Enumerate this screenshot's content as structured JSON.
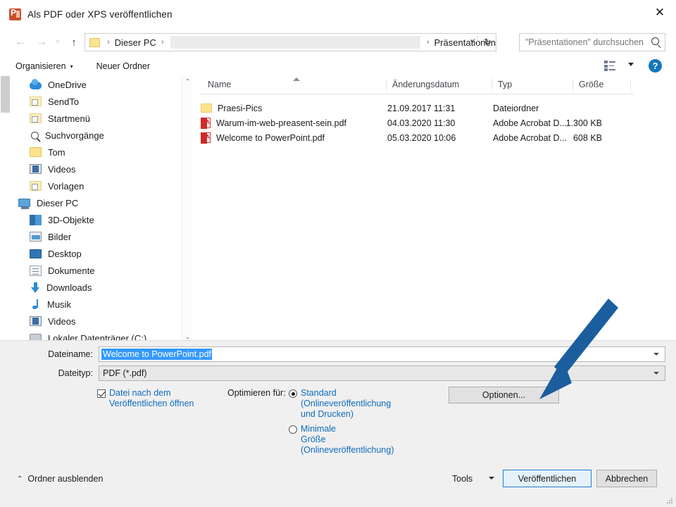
{
  "window": {
    "title": "Als PDF oder XPS veröffentlichen",
    "app_icon": "powerpoint-icon",
    "close_label": "✕"
  },
  "nav": {
    "back_icon": "←",
    "forward_icon": "→",
    "recent_icon": "˅",
    "up_icon": "↑"
  },
  "address": {
    "crumb_root": "Dieser PC",
    "crumb_current": "Präsentationen",
    "separator": "›",
    "dropdown_icon": "˅",
    "refresh_icon": "↻"
  },
  "search": {
    "placeholder": "\"Präsentationen\" durchsuchen",
    "icon": "search-icon"
  },
  "commandbar": {
    "organize_label": "Organisieren",
    "organize_caret": "▾",
    "new_folder_label": "Neuer Ordner",
    "view_icon": "view-layout-icon",
    "view_caret": "▾",
    "help_label": "?"
  },
  "sidebar": {
    "items": [
      {
        "label": "OneDrive",
        "icon": "cloud-icon",
        "indent": "child"
      },
      {
        "label": "SendTo",
        "icon": "folder-shortcut-icon",
        "indent": "child"
      },
      {
        "label": "Startmenü",
        "icon": "folder-shortcut-icon",
        "indent": "child"
      },
      {
        "label": "Suchvorgänge",
        "icon": "search-folder-icon",
        "indent": "child"
      },
      {
        "label": "Tom",
        "icon": "folder-icon",
        "indent": "child"
      },
      {
        "label": "Videos",
        "icon": "video-folder-icon",
        "indent": "child"
      },
      {
        "label": "Vorlagen",
        "icon": "folder-shortcut-icon",
        "indent": "child"
      },
      {
        "label": "Dieser PC",
        "icon": "computer-icon",
        "indent": "root"
      },
      {
        "label": "3D-Objekte",
        "icon": "3d-objects-icon",
        "indent": "child"
      },
      {
        "label": "Bilder",
        "icon": "pictures-icon",
        "indent": "child"
      },
      {
        "label": "Desktop",
        "icon": "desktop-icon",
        "indent": "child"
      },
      {
        "label": "Dokumente",
        "icon": "documents-icon",
        "indent": "child"
      },
      {
        "label": "Downloads",
        "icon": "downloads-icon",
        "indent": "child"
      },
      {
        "label": "Musik",
        "icon": "music-icon",
        "indent": "child"
      },
      {
        "label": "Videos",
        "icon": "video-folder-icon",
        "indent": "child"
      },
      {
        "label": "Lokaler Datenträger (C:)",
        "icon": "drive-icon",
        "indent": "child"
      }
    ],
    "scroll_up_icon": "⌃",
    "scroll_down_icon": "⌄"
  },
  "filelist": {
    "columns": [
      "Name",
      "Änderungsdatum",
      "Typ",
      "Größe"
    ],
    "sort_column": "Name",
    "sort_direction": "asc",
    "rows": [
      {
        "name": "Praesi-Pics",
        "date": "21.09.2017 11:31",
        "type": "Dateiordner",
        "size": "",
        "icon": "folder-icon"
      },
      {
        "name": "Warum-im-web-preasent-sein.pdf",
        "date": "04.03.2020 11:30",
        "type": "Adobe Acrobat D...",
        "size": "1.300 KB",
        "icon": "pdf-icon"
      },
      {
        "name": "Welcome to PowerPoint.pdf",
        "date": "05.03.2020 10:06",
        "type": "Adobe Acrobat D...",
        "size": "608 KB",
        "icon": "pdf-icon"
      }
    ]
  },
  "form": {
    "filename_label": "Dateiname:",
    "filename_value": "Welcome to PowerPoint.pdf",
    "filetype_label": "Dateityp:",
    "filetype_value": "PDF (*.pdf)",
    "open_after_publish_label": "Datei nach dem Veröffentlichen öffnen",
    "open_after_publish_checked": true,
    "optimize_label": "Optimieren für:",
    "radio_options": [
      {
        "label": "Standard (Onlineveröffentlichung und Drucken)",
        "selected": true
      },
      {
        "label": "Minimale Größe (Onlineveröffentlichung)",
        "selected": false
      }
    ],
    "options_button": "Optionen..."
  },
  "footer": {
    "hide_folders_label": "Ordner ausblenden",
    "hide_folders_caret": "⌃",
    "tools_label": "Tools",
    "tools_caret": "▾",
    "publish_label": "Veröffentlichen",
    "cancel_label": "Abbrechen"
  },
  "annotation": {
    "type": "arrow",
    "color": "#1a5e9e",
    "points_at": "Optionen..."
  },
  "colors": {
    "accent_blue": "#0f6cbd",
    "selection_blue": "#3399ff",
    "default_button_border": "#1e7fd4",
    "annotation_arrow": "#1a5e9e",
    "panel_background": "#f0f0f0"
  }
}
